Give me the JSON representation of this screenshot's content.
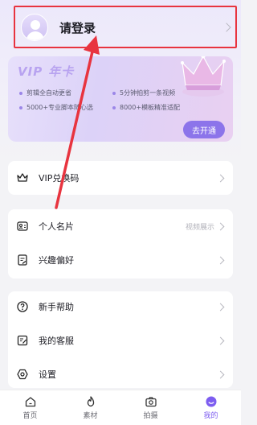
{
  "profile": {
    "login_label": "请登录"
  },
  "vip": {
    "title_latin": "VIP",
    "title_cn": "年卡",
    "features": [
      "剪辑全自动更省",
      "5分钟拍剪一条视频",
      "5000+专业脚本随心选",
      "8000+模板精准适配"
    ],
    "open_button": "去开通"
  },
  "menu": {
    "vip_code": "VIP兑换码",
    "business_card": "个人名片",
    "business_card_extra": "视频展示",
    "interests": "兴趣偏好",
    "newbie_help": "新手帮助",
    "customer_service": "我的客服",
    "settings": "设置"
  },
  "nav": {
    "home": "首页",
    "materials": "素材",
    "shoot": "拍摄",
    "mine": "我的",
    "active": "mine"
  },
  "colors": {
    "accent": "#7d5df0",
    "annotation": "#e8343f"
  }
}
